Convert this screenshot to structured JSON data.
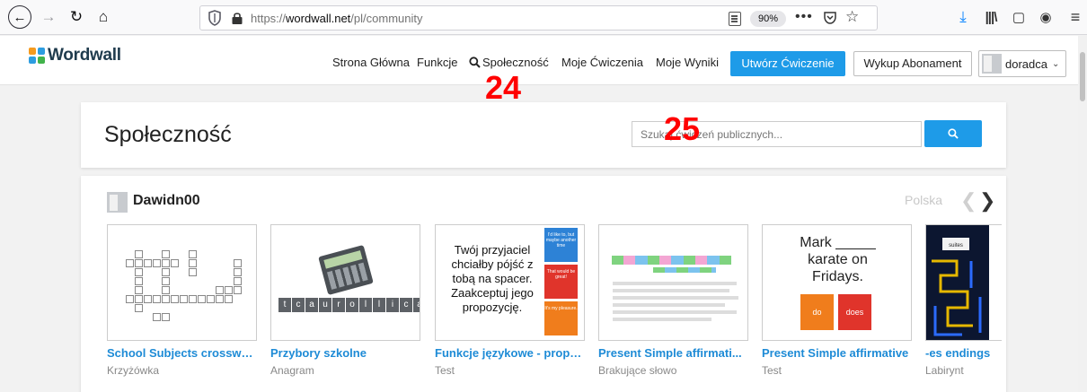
{
  "browser": {
    "url_prefix": "https://",
    "url_domain": "wordwall.net",
    "url_path": "/pl/community",
    "zoom": "90%",
    "more_label": "•••"
  },
  "header": {
    "logo": "Wordwall",
    "nav": [
      "Strona Główna",
      "Funkcje",
      "Społeczność",
      "Moje Ćwiczenia",
      "Moje Wyniki"
    ],
    "create_label": "Utwórz Ćwiczenie",
    "subscribe_label": "Wykup Abonament",
    "user_name": "doradca",
    "caret": "⌄"
  },
  "overlays": {
    "first": "24",
    "second": "25"
  },
  "community": {
    "title": "Społeczność",
    "search_placeholder": "Szukaj ćwiczeń publicznych..."
  },
  "section": {
    "username": "Dawidn00",
    "language": "Polska",
    "prev": "❮",
    "next": "❯",
    "activities": [
      {
        "title": "School Subjects crossword",
        "type": "Krzyżówka"
      },
      {
        "title": "Przybory szkolne",
        "type": "Anagram"
      },
      {
        "title": "Funkcje językowe - propo...",
        "type": "Test"
      },
      {
        "title": "Present Simple affirmati...",
        "type": "Brakujące słowo"
      },
      {
        "title": "Present Simple affirmative",
        "type": "Test"
      },
      {
        "title": "-es endings",
        "type": "Labirynt"
      }
    ],
    "thumbs": {
      "anagram_tiles": [
        "t",
        "c",
        "a",
        "u",
        "r",
        "o",
        "l",
        "l",
        "i",
        "c",
        "a"
      ],
      "funkcje_text": "Twój przyjaciel chciałby pójść z tobą na spacer. Zaakceptuj jego propozycję.",
      "funkcje_options": [
        "I'd like to, but maybe another time",
        "That would be great!",
        "It's my pleasure."
      ],
      "mark_text": "Mark _____ karate on Fridays.",
      "mark_options": [
        "do",
        "does"
      ],
      "maze_label": "suites"
    }
  },
  "colors": {
    "accent": "#1e9be8",
    "link": "#1e8bd6",
    "overlay": "#ff0000"
  }
}
